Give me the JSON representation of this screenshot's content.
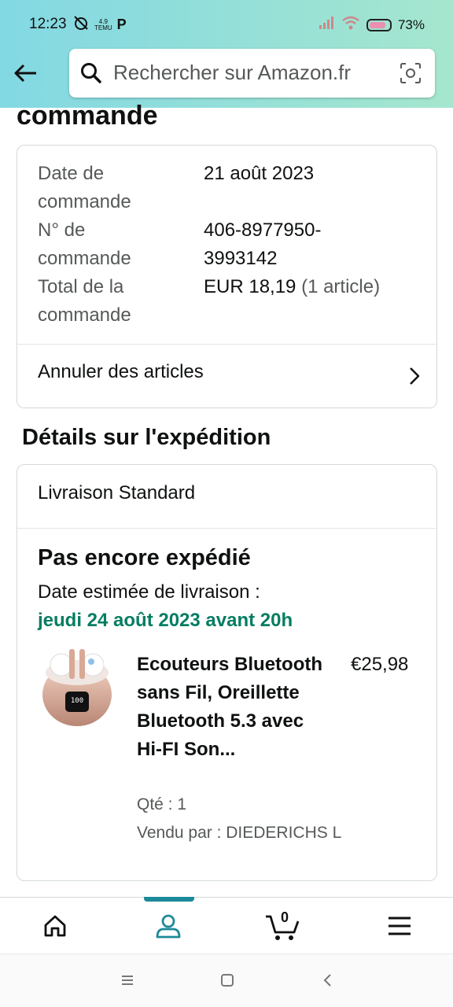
{
  "status_bar": {
    "time": "12:23",
    "small_label_1": "4.9",
    "small_label_2": "TEMU",
    "p_label": "P",
    "battery": "73%"
  },
  "search": {
    "placeholder": "Rechercher sur Amazon.fr"
  },
  "page": {
    "title_partial": "commande"
  },
  "order_summary": {
    "rows": [
      {
        "label": "Date de\ncommande",
        "value": "21 août 2023"
      },
      {
        "label": "N° de\ncommande",
        "value": "406-8977950-\n3993142"
      },
      {
        "label": "Total de la\ncommande",
        "value": "EUR 18,19",
        "note": "(1 article)"
      }
    ],
    "cancel_label": "Annuler des articles"
  },
  "shipping": {
    "section_title": "Détails sur l'expédition",
    "delivery_type": "Livraison Standard",
    "status": "Pas encore expédié",
    "estimate_label": "Date estimée de livraison :",
    "estimate_date": "jeudi 24 août 2023 avant 20h",
    "product": {
      "title": "Ecouteurs Bluetooth sans Fil, Oreillette Bluetooth 5.3 avec Hi-FI Son...",
      "price": "€25,98",
      "quantity": "Qté : 1",
      "seller": "Vendu par : DIEDERICHS L",
      "display_digits": "100"
    }
  },
  "bottom_nav": {
    "items": [
      "home-icon",
      "account-icon",
      "cart-icon",
      "menu-icon"
    ],
    "active": "account-icon",
    "cart_count": "0"
  },
  "colors": {
    "header_gradient_start": "#82d8e3",
    "header_gradient_end": "#a5e6ce",
    "delivery_green": "#067d62",
    "nav_accent": "#1d8a99"
  }
}
